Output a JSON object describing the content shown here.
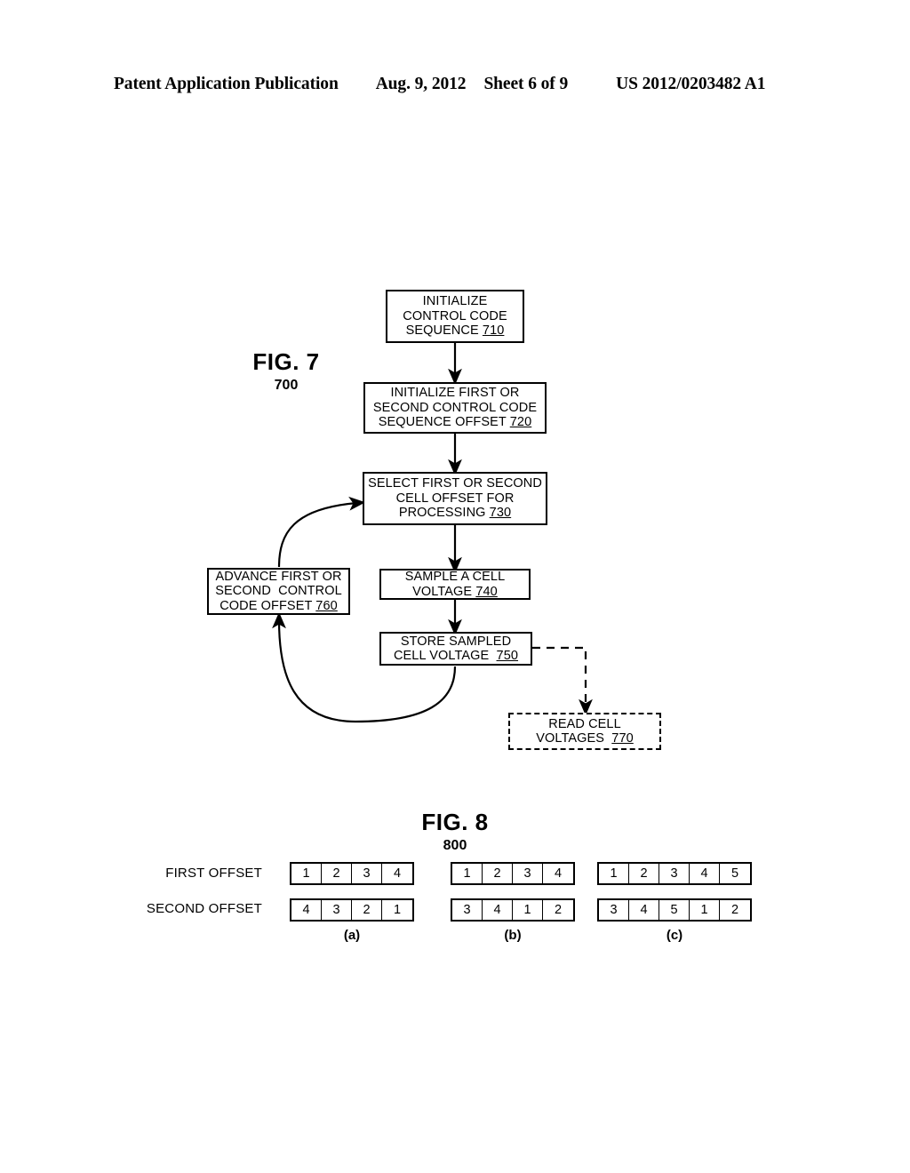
{
  "header": {
    "publication": "Patent Application Publication",
    "date": "Aug. 9, 2012",
    "sheet": "Sheet 6 of 9",
    "patent_number": "US 2012/0203482 A1"
  },
  "figure7": {
    "caption_title": "FIG. 7",
    "caption_number": "700",
    "boxes": [
      {
        "id": "710",
        "line1": "INITIALIZE",
        "line2": "CONTROL CODE",
        "line3": "SEQUENCE ",
        "ref": "710",
        "style": "solid"
      },
      {
        "id": "720",
        "line1": "INITIALIZE FIRST OR",
        "line2": "SECOND CONTROL CODE",
        "line3": "SEQUENCE OFFSET ",
        "ref": "720",
        "style": "solid"
      },
      {
        "id": "730",
        "line1": "SELECT FIRST OR SECOND",
        "line2": "CELL OFFSET FOR",
        "line3": "PROCESSING ",
        "ref": "730",
        "style": "solid"
      },
      {
        "id": "740",
        "line1": "SAMPLE A CELL",
        "line2": "VOLTAGE ",
        "line3": "",
        "ref": "740",
        "style": "solid"
      },
      {
        "id": "750",
        "line1": "STORE SAMPLED",
        "line2": "CELL VOLTAGE  ",
        "line3": "",
        "ref": "750",
        "style": "solid"
      },
      {
        "id": "760",
        "line1": "ADVANCE FIRST OR",
        "line2": "SECOND  CONTROL",
        "line3": "CODE OFFSET ",
        "ref": "760",
        "style": "solid"
      },
      {
        "id": "770",
        "line1": "READ CELL",
        "line2": "VOLTAGES  ",
        "line3": "",
        "ref": "770",
        "style": "dashed"
      }
    ]
  },
  "figure8": {
    "caption_title": "FIG. 8",
    "caption_number": "800",
    "row_labels": [
      "FIRST OFFSET",
      "SECOND OFFSET"
    ],
    "group_labels": [
      "(a)",
      "(b)",
      "(c)"
    ],
    "groups": [
      {
        "label": "(a)",
        "first_offset": [
          "1",
          "2",
          "3",
          "4"
        ],
        "second_offset": [
          "4",
          "3",
          "2",
          "1"
        ]
      },
      {
        "label": "(b)",
        "first_offset": [
          "1",
          "2",
          "3",
          "4"
        ],
        "second_offset": [
          "3",
          "4",
          "1",
          "2"
        ]
      },
      {
        "label": "(c)",
        "first_offset": [
          "1",
          "2",
          "3",
          "4",
          "5"
        ],
        "second_offset": [
          "3",
          "4",
          "5",
          "1",
          "2"
        ]
      }
    ]
  },
  "colors": {
    "ink": "#000000",
    "paper": "#ffffff"
  }
}
